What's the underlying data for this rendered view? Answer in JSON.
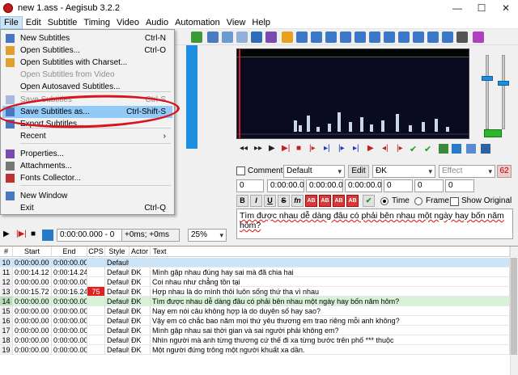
{
  "window": {
    "title": "new 1.ass - Aegisub 3.2.2",
    "minimize": "—",
    "maximize": "☐",
    "close": "✕"
  },
  "menubar": [
    "File",
    "Edit",
    "Subtitle",
    "Timing",
    "Video",
    "Audio",
    "Automation",
    "View",
    "Help"
  ],
  "file_menu": {
    "items": [
      {
        "label": "New Subtitles",
        "shortcut": "Ctrl-N",
        "enabled": true,
        "icon": "new-file-icon"
      },
      {
        "label": "Open Subtitles...",
        "shortcut": "Ctrl-O",
        "enabled": true,
        "icon": "open-folder-icon"
      },
      {
        "label": "Open Subtitles with Charset...",
        "shortcut": "",
        "enabled": true,
        "icon": "open-charset-icon"
      },
      {
        "label": "Open Subtitles from Video",
        "shortcut": "",
        "enabled": false,
        "icon": ""
      },
      {
        "label": "Open Autosaved Subtitles...",
        "shortcut": "",
        "enabled": true,
        "icon": ""
      },
      {
        "label": "Save Subtitles",
        "shortcut": "Ctrl-S",
        "enabled": false,
        "icon": "save-icon"
      },
      {
        "label": "Save Subtitles as...",
        "shortcut": "Ctrl-Shift-S",
        "enabled": true,
        "icon": "save-as-icon"
      },
      {
        "label": "Export Subtitles...",
        "shortcut": "",
        "enabled": true,
        "icon": "export-icon"
      },
      {
        "label": "Recent",
        "shortcut": "›",
        "enabled": true,
        "icon": ""
      },
      {
        "label": "Properties...",
        "shortcut": "",
        "enabled": true,
        "icon": "properties-icon"
      },
      {
        "label": "Attachments...",
        "shortcut": "",
        "enabled": true,
        "icon": "attachment-icon"
      },
      {
        "label": "Fonts Collector...",
        "shortcut": "",
        "enabled": true,
        "icon": "fonts-icon"
      },
      {
        "label": "New Window",
        "shortcut": "",
        "enabled": true,
        "icon": "new-window-icon"
      },
      {
        "label": "Exit",
        "shortcut": "Ctrl-Q",
        "enabled": true,
        "icon": ""
      }
    ]
  },
  "editbox": {
    "comment_label": "Comment",
    "style": "Default",
    "edit_button": "Edit",
    "actor": "ĐK",
    "effect_placeholder": "Effect",
    "char_count": "62",
    "layer": "0",
    "start_time": "0:00:00.00",
    "end_time": "0:00:00.00",
    "duration": "0:00:00.00",
    "margin_l": "0",
    "margin_r": "0",
    "margin_v": "0",
    "format_buttons": [
      "B",
      "I",
      "U",
      "S",
      "fn",
      "AB",
      "AB",
      "AB",
      "AB"
    ],
    "time_label": "Time",
    "frame_label": "Frame",
    "show_original_label": "Show Original",
    "text": "Tìm được nhau dễ dàng đâu có phải bên nhau một ngày hay bốn năm hôm?"
  },
  "video_controls": {
    "time": "0:00:00.000 - 0",
    "offset": "+0ms; +0ms",
    "zoom": "25%"
  },
  "grid": {
    "headers": [
      "#",
      "Start",
      "End",
      "CPS",
      "Style",
      "Actor",
      "Text"
    ],
    "rows": [
      {
        "num": "10",
        "start": "0:00:00.00",
        "end": "0:00:00.00",
        "cps": "",
        "style": "Default",
        "actor": "",
        "text": "",
        "state": "selected"
      },
      {
        "num": "11",
        "start": "0:00:14.12",
        "end": "0:00:14.24",
        "cps": "",
        "style": "Default",
        "actor": "ĐK",
        "text": "Mình gặp nhau đúng hay sai mà đã chia hai",
        "state": ""
      },
      {
        "num": "12",
        "start": "0:00:00.00",
        "end": "0:00:00.00",
        "cps": "",
        "style": "Default",
        "actor": "ĐK",
        "text": "Coi nhau như chẳng tồn tại",
        "state": ""
      },
      {
        "num": "13",
        "start": "0:00:15.72",
        "end": "0:00:16.24",
        "cps": "75",
        "style": "Default",
        "actor": "ĐK",
        "text": "Hợp nhau là do mình thôi luôn sống thứ tha vì nhau",
        "state": ""
      },
      {
        "num": "14",
        "start": "0:00:00.00",
        "end": "0:00:00.00",
        "cps": "",
        "style": "Default",
        "actor": "ĐK",
        "text": "Tìm được nhau dễ dàng đâu có phải bên nhau một ngày hay bốn năm hôm?",
        "state": "active"
      },
      {
        "num": "15",
        "start": "0:00:00.00",
        "end": "0:00:00.00",
        "cps": "",
        "style": "Default",
        "actor": "ĐK",
        "text": "Nay em nói câu không hợp là do duyên số hay sao?",
        "state": ""
      },
      {
        "num": "16",
        "start": "0:00:00.00",
        "end": "0:00:00.00",
        "cps": "",
        "style": "Default",
        "actor": "ĐK",
        "text": "Vậy em có chắc bao năm mọi thứ yêu thương em trao riêng mỗi anh không?",
        "state": ""
      },
      {
        "num": "17",
        "start": "0:00:00.00",
        "end": "0:00:00.00",
        "cps": "",
        "style": "Default",
        "actor": "ĐK",
        "text": "Mình gặp nhau sai thời gian và sai người phải không em?",
        "state": ""
      },
      {
        "num": "18",
        "start": "0:00:00.00",
        "end": "0:00:00.00",
        "cps": "",
        "style": "Default",
        "actor": "ĐK",
        "text": "Nhìn người mà anh từng thương cứ thế đi xa từng bước trên phố *** thuộc",
        "state": ""
      },
      {
        "num": "19",
        "start": "0:00:00.00",
        "end": "0:00:00.00",
        "cps": "",
        "style": "Default",
        "actor": "ĐK",
        "text": "Một người đứng trông một người khuất xa dần.",
        "state": ""
      }
    ]
  },
  "colors": {
    "accent": "#1e8fe0",
    "highlight": "#91c9f7",
    "annotation": "#d8141e"
  }
}
